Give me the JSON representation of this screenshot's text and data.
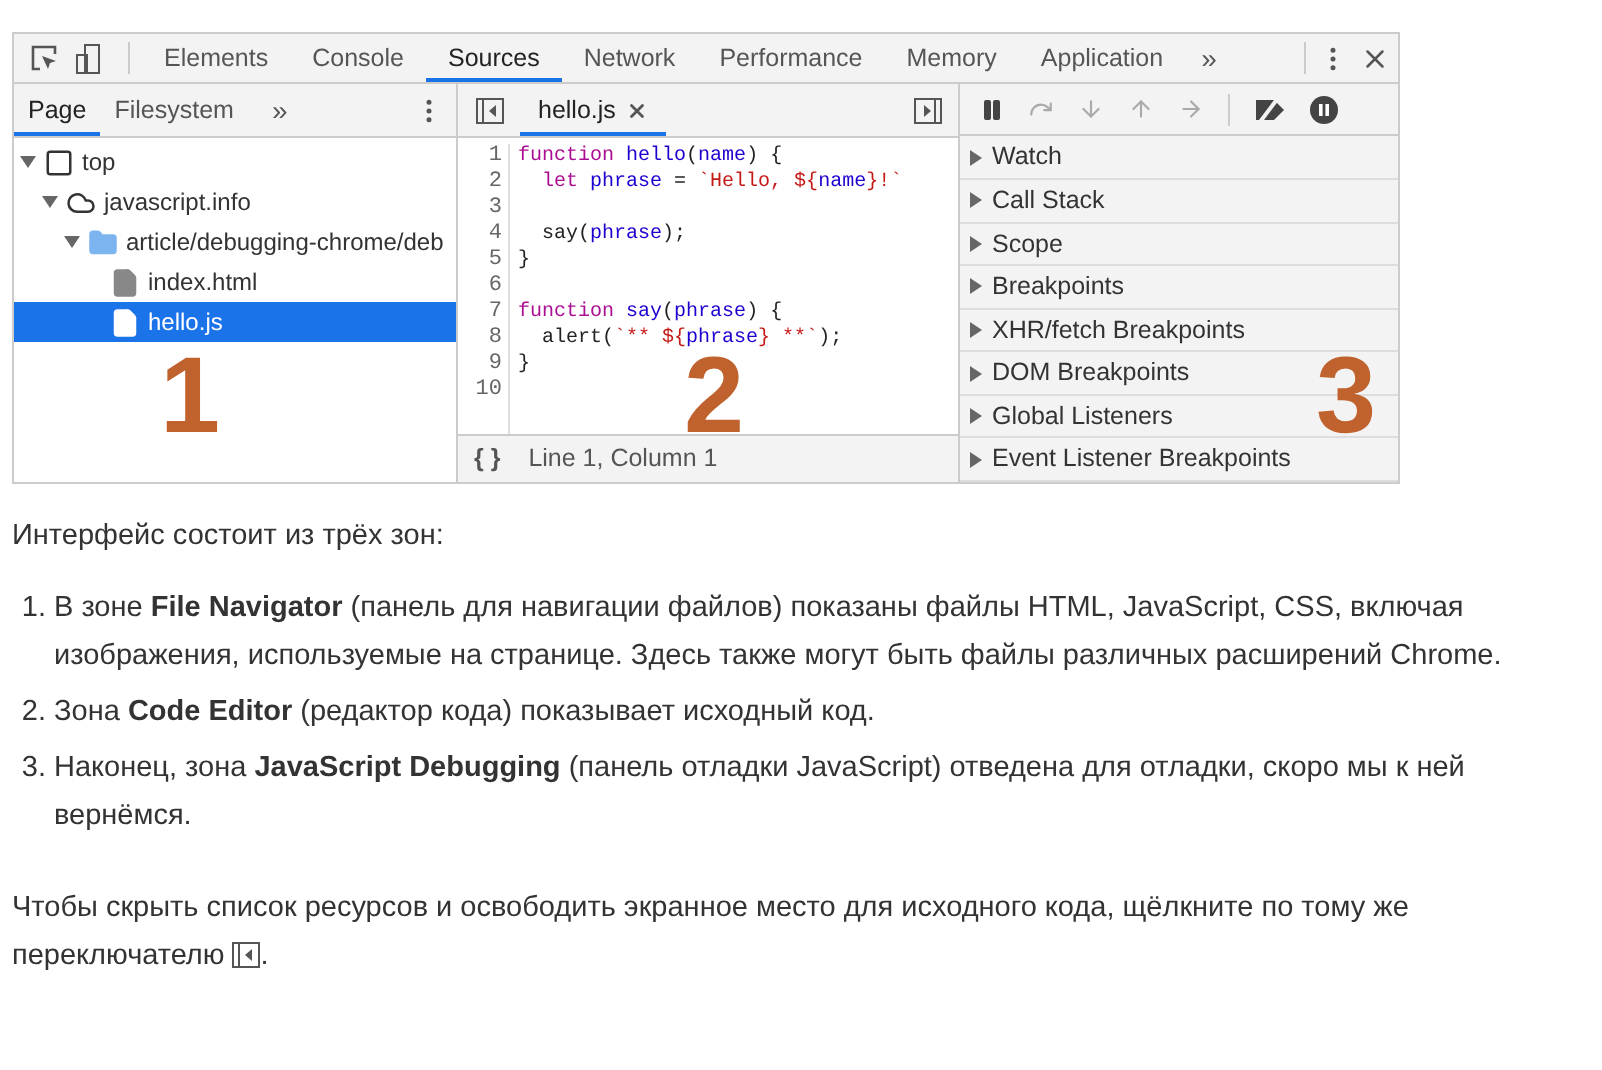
{
  "devtools": {
    "main_tabs": [
      {
        "label": "Elements",
        "selected": false
      },
      {
        "label": "Console",
        "selected": false
      },
      {
        "label": "Sources",
        "selected": true
      },
      {
        "label": "Network",
        "selected": false
      },
      {
        "label": "Performance",
        "selected": false
      },
      {
        "label": "Memory",
        "selected": false
      },
      {
        "label": "Application",
        "selected": false
      }
    ],
    "more_tabs": "»",
    "navigator": {
      "tabs": [
        {
          "label": "Page",
          "selected": true
        },
        {
          "label": "Filesystem",
          "selected": false
        }
      ],
      "more_tabs": "»",
      "tree": [
        {
          "label": "top",
          "kind": "frame",
          "expanded": true,
          "selected": false,
          "children": [
            {
              "label": "javascript.info",
              "kind": "domain",
              "expanded": true,
              "selected": false,
              "children": [
                {
                  "label": "article/debugging-chrome/deb",
                  "kind": "folder",
                  "expanded": true,
                  "selected": false,
                  "children": [
                    {
                      "label": "index.html",
                      "kind": "file",
                      "selected": false
                    },
                    {
                      "label": "hello.js",
                      "kind": "file",
                      "selected": true
                    }
                  ]
                }
              ]
            }
          ]
        }
      ],
      "zone_number": "1"
    },
    "editor": {
      "tabs": [
        {
          "label": "hello.js",
          "selected": true
        }
      ],
      "lines": [
        {
          "number": "1",
          "tokens": [
            {
              "text": "function ",
              "kind": "keyword"
            },
            {
              "text": "hello",
              "kind": "name"
            },
            {
              "text": "(",
              "kind": "plain"
            },
            {
              "text": "name",
              "kind": "name"
            },
            {
              "text": ") {",
              "kind": "plain"
            }
          ]
        },
        {
          "number": "2",
          "tokens": [
            {
              "text": "  let ",
              "kind": "keyword"
            },
            {
              "text": "phrase",
              "kind": "name"
            },
            {
              "text": " = ",
              "kind": "plain"
            },
            {
              "text": "`Hello, ${",
              "kind": "string"
            },
            {
              "text": "name",
              "kind": "name"
            },
            {
              "text": "}!`",
              "kind": "string"
            }
          ]
        },
        {
          "number": "3"
        },
        {
          "number": "4",
          "tokens": [
            {
              "text": "  say(",
              "kind": "plain"
            },
            {
              "text": "phrase",
              "kind": "name"
            },
            {
              "text": ");",
              "kind": "plain"
            }
          ]
        },
        {
          "number": "5",
          "tokens": [
            {
              "text": "}",
              "kind": "plain"
            }
          ]
        },
        {
          "number": "6"
        },
        {
          "number": "7",
          "tokens": [
            {
              "text": "function ",
              "kind": "keyword"
            },
            {
              "text": "say",
              "kind": "name"
            },
            {
              "text": "(",
              "kind": "plain"
            },
            {
              "text": "phrase",
              "kind": "name"
            },
            {
              "text": ") {",
              "kind": "plain"
            }
          ]
        },
        {
          "number": "8",
          "tokens": [
            {
              "text": "  alert(",
              "kind": "plain"
            },
            {
              "text": "`** ${",
              "kind": "string"
            },
            {
              "text": "phrase",
              "kind": "name"
            },
            {
              "text": "} **`",
              "kind": "string"
            },
            {
              "text": ");",
              "kind": "plain"
            }
          ]
        },
        {
          "number": "9",
          "tokens": [
            {
              "text": "}",
              "kind": "plain"
            }
          ]
        },
        {
          "number": "10"
        }
      ],
      "format_button": "{ }",
      "cursor_position": "Line 1, Column 1",
      "zone_number": "2"
    },
    "debugger": {
      "sections": [
        {
          "label": "Watch",
          "expanded": false
        },
        {
          "label": "Call Stack",
          "expanded": false
        },
        {
          "label": "Scope",
          "expanded": false
        },
        {
          "label": "Breakpoints",
          "expanded": false
        },
        {
          "label": "XHR/fetch Breakpoints",
          "expanded": false
        },
        {
          "label": "DOM Breakpoints",
          "expanded": false
        },
        {
          "label": "Global Listeners",
          "expanded": false
        },
        {
          "label": "Event Listener Breakpoints",
          "expanded": false
        }
      ],
      "zone_number": "3"
    }
  },
  "article": {
    "intro": "Интерфейс состоит из трёх зон:",
    "items": [
      {
        "number": "1.",
        "text": "В зоне **File Navigator** (панель для навигации файлов) показаны файлы HTML, JavaScript, CSS, включая изображения, используемые на странице. Здесь также могут быть файлы различных расширений Chrome."
      },
      {
        "number": "2.",
        "text": "Зона **Code Editor** (редактор кода) показывает исходный код."
      },
      {
        "number": "3.",
        "text": "Наконец, зона **JavaScript Debugging** (панель отладки JavaScript) отведена для отладки, скоро мы к ней вернёмся."
      }
    ],
    "outro": {
      "text": "Чтобы скрыть список ресурсов и освободить экранное место для исходного кода, щёлкните по тому же переключателю",
      "after_icon": "."
    }
  }
}
